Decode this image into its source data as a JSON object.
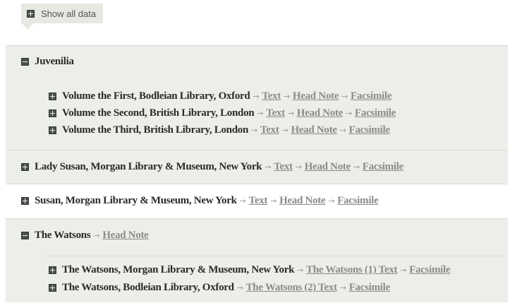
{
  "toolbar": {
    "show_all_label": "Show all data"
  },
  "sections": [
    {
      "title": "Juvenilia",
      "expanded": true,
      "items": [
        {
          "title": "Volume the First, Bodleian Library, Oxford",
          "links": [
            "Text",
            "Head Note",
            "Facsimile"
          ]
        },
        {
          "title": "Volume the Second, British Library, London",
          "links": [
            "Text",
            "Head Note",
            "Facsimile"
          ]
        },
        {
          "title": "Volume the Third, British Library, London",
          "links": [
            "Text",
            "Head Note",
            "Facsimile"
          ]
        }
      ]
    },
    {
      "title": "Lady Susan, Morgan Library & Museum, New York",
      "expanded": false,
      "links": [
        "Text",
        "Head Note",
        "Facsimile"
      ]
    },
    {
      "title": "Susan, Morgan Library & Museum, New York",
      "expanded": false,
      "links": [
        "Text",
        "Head Note",
        "Facsimile"
      ]
    },
    {
      "title": "The Watsons",
      "expanded": true,
      "links": [
        "Head Note"
      ],
      "items": [
        {
          "title": "The Watsons, Morgan Library & Museum, New York",
          "links": [
            "The Watsons (1) Text",
            "Facsimile"
          ]
        },
        {
          "title": "The Watsons, Bodleian Library, Oxford",
          "links": [
            "The Watsons (2) Text",
            "Facsimile"
          ]
        }
      ]
    }
  ],
  "separator": "→"
}
